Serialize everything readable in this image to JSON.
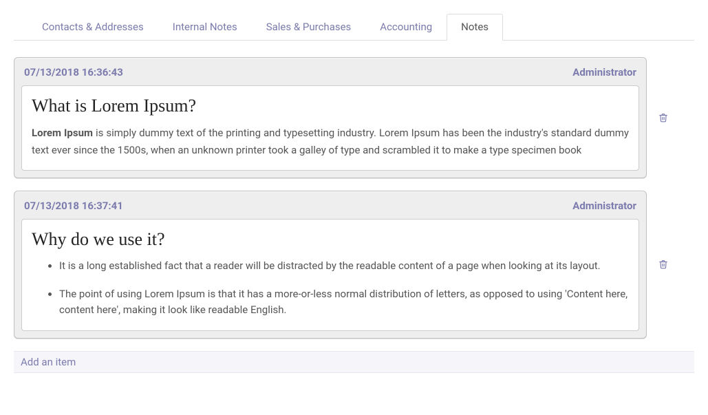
{
  "tabs": [
    {
      "label": "Contacts & Addresses",
      "active": false
    },
    {
      "label": "Internal Notes",
      "active": false
    },
    {
      "label": "Sales & Purchases",
      "active": false
    },
    {
      "label": "Accounting",
      "active": false
    },
    {
      "label": "Notes",
      "active": true
    }
  ],
  "notes": [
    {
      "timestamp": "07/13/2018 16:36:43",
      "author": "Administrator",
      "title": "What is Lorem Ipsum?",
      "body_lead": "Lorem Ipsum",
      "body_rest": " is simply dummy text of the printing and typesetting industry. Lorem Ipsum has been the industry's standard dummy text ever since the 1500s, when an unknown printer took a galley of type and scrambled it to make a type specimen book",
      "bullets": null
    },
    {
      "timestamp": "07/13/2018 16:37:41",
      "author": "Administrator",
      "title": "Why do we use it?",
      "body_lead": null,
      "body_rest": null,
      "bullets": [
        "It is a long established fact that a reader will be distracted by the readable content of a page when looking at its layout.",
        "The point of using Lorem Ipsum is that it has a more-or-less normal distribution of letters, as opposed to using 'Content here, content here', making it look like readable English."
      ]
    }
  ],
  "add_item_label": "Add an item"
}
